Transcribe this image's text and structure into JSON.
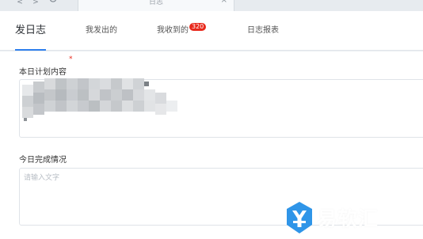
{
  "window": {
    "back_glyph": "<",
    "forward_glyph": ">",
    "tab_title": "日志",
    "close_glyph": "×"
  },
  "tabs": [
    {
      "label": "发日志",
      "active": true
    },
    {
      "label": "我发出的",
      "active": false
    },
    {
      "label": "我收到的",
      "active": false,
      "badge": "320"
    },
    {
      "label": "日志报表",
      "active": false
    }
  ],
  "form": {
    "plan": {
      "label": "本日计划内容",
      "required_mark": "*"
    },
    "completion": {
      "label": "今日完成情况",
      "placeholder": "请输入文字"
    }
  },
  "watermark": {
    "text": "易软汇"
  },
  "colors": {
    "accent": "#2f80ed",
    "badge": "#e8291c",
    "watermark_icon": "#2f95e8"
  }
}
